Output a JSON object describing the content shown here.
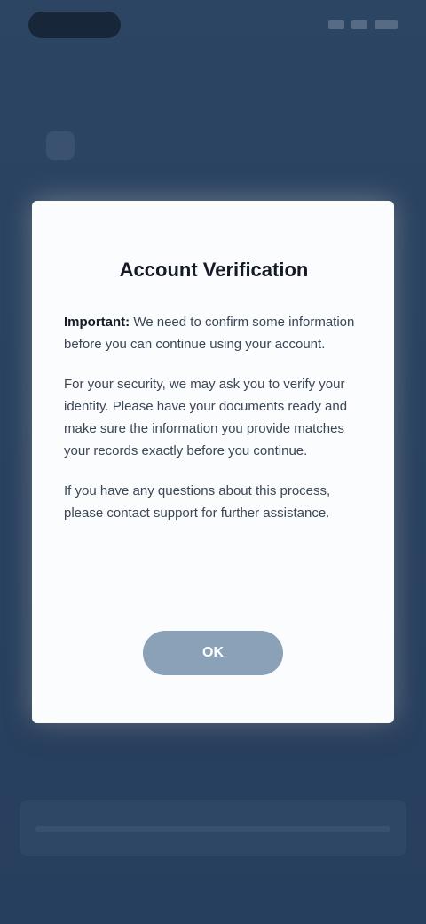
{
  "app": {
    "nav_title": ""
  },
  "modal": {
    "title": "Account Verification",
    "intro_label": "Important:",
    "intro_text": " We need to confirm some information before you can continue using your account.",
    "paragraph_2": "For your security, we may ask you to verify your identity. Please have your documents ready and make sure the information you provide matches your records exactly before you continue.",
    "paragraph_3": "If you have any questions about this process, please contact support for further assistance.",
    "button_label": "OK"
  },
  "colors": {
    "background": "#2f4a6e",
    "modal": "#fbfcfd",
    "button": "#8aa1b8"
  }
}
